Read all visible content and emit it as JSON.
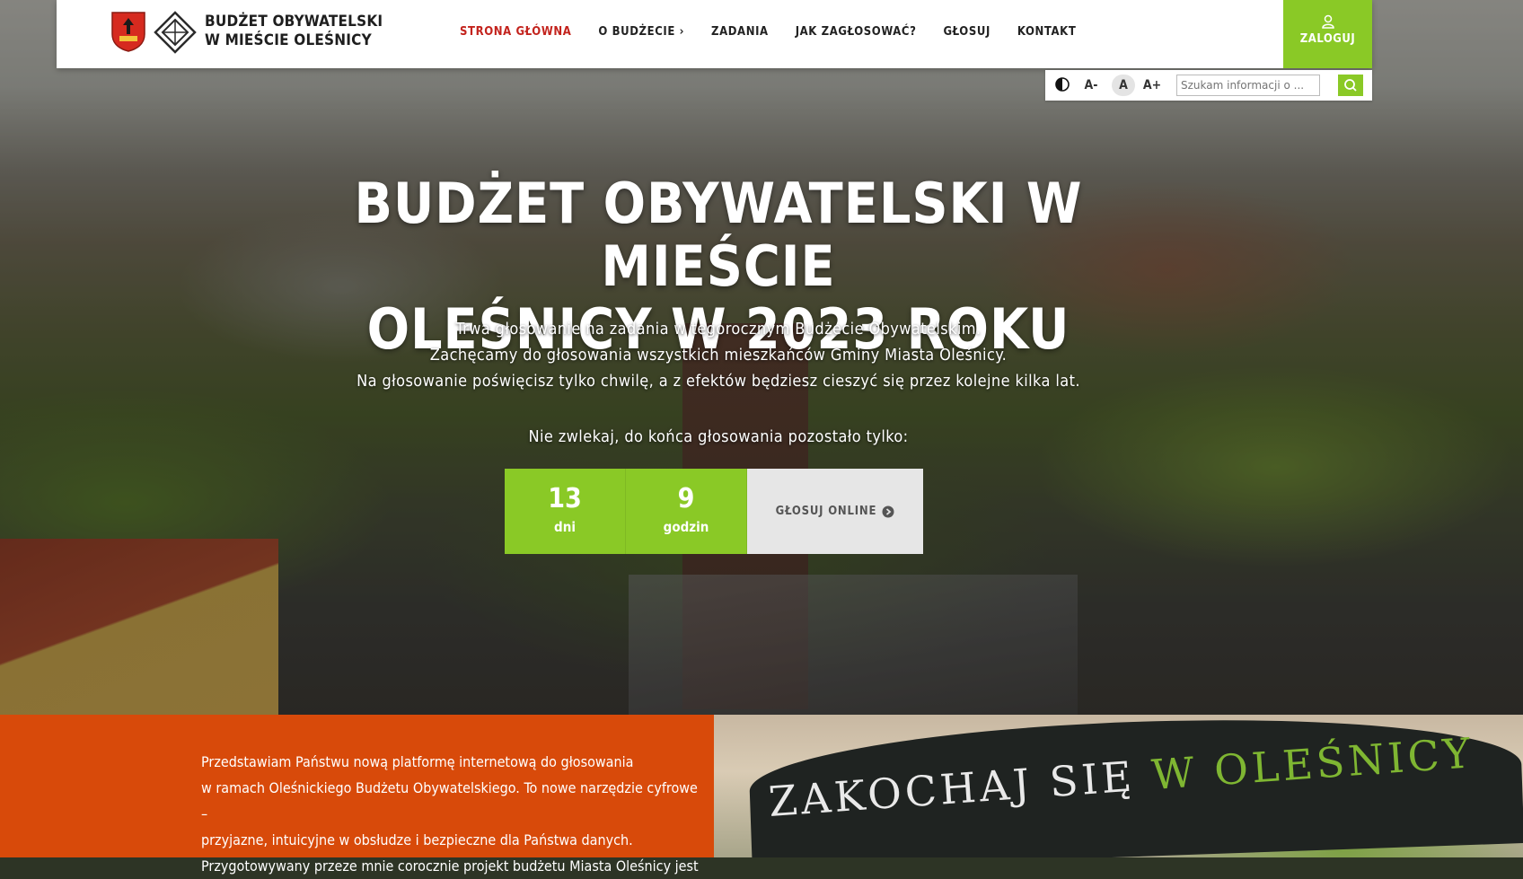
{
  "header": {
    "logo_line1": "BUDŻET OBYWATELSKI",
    "logo_line2": "W MIEŚCIE OLEŚNICY",
    "nav": [
      {
        "label": "STRONA GŁÓWNA",
        "active": true
      },
      {
        "label": "O BUDŻECIE ›"
      },
      {
        "label": "ZADANIA"
      },
      {
        "label": "JAK ZAGŁOSOWAĆ?"
      },
      {
        "label": "GŁOSUJ"
      },
      {
        "label": "KONTAKT"
      }
    ],
    "login_label": "ZALOGUJ"
  },
  "toolbar": {
    "font_decrease": "A-",
    "font_normal": "A",
    "font_increase": "A+",
    "search_placeholder": "Szukam informacji o ..."
  },
  "hero": {
    "title_line1": "BUDŻET OBYWATELSKI W MIEŚCIE",
    "title_line2": "OLEŚNICY W 2023 ROKU",
    "sub_line1": "Trwa głosowanie na zadania w tegorocznym Budżecie Obywatelskim.",
    "sub_line2": "Zachęcamy do głosowania wszystkich mieszkańców Gminy Miasta Oleśnicy.",
    "sub_line3": "Na głosowanie poświęcisz tylko chwilę, a z efektów będziesz cieszyć się przez kolejne kilka lat.",
    "cta_text": "Nie zwlekaj, do końca głosowania pozostało tylko:",
    "countdown": [
      {
        "value": "13",
        "unit": "dni"
      },
      {
        "value": "9",
        "unit": "godzin"
      }
    ],
    "vote_button": "GŁOSUJ ONLINE"
  },
  "intro": {
    "line1": "Przedstawiam Państwu nową platformę internetową do głosowania",
    "line2": "w ramach Oleśnickiego Budżetu Obywatelskiego. To nowe narzędzie cyfrowe –",
    "line3": "przyjazne, intuicyjne w obsłudze i bezpieczne dla Państwa danych.",
    "line4": "Przygotowywany przeze mnie corocznie projekt budżetu Miasta Oleśnicy jest"
  },
  "photo": {
    "sign_part1": "ZAKOCHAJ SIĘ ",
    "sign_part2": "W OLEŚNICY"
  },
  "colors": {
    "accent_green": "#8ac926",
    "active_red": "#c3231d",
    "intro_orange": "#d84a0a"
  }
}
